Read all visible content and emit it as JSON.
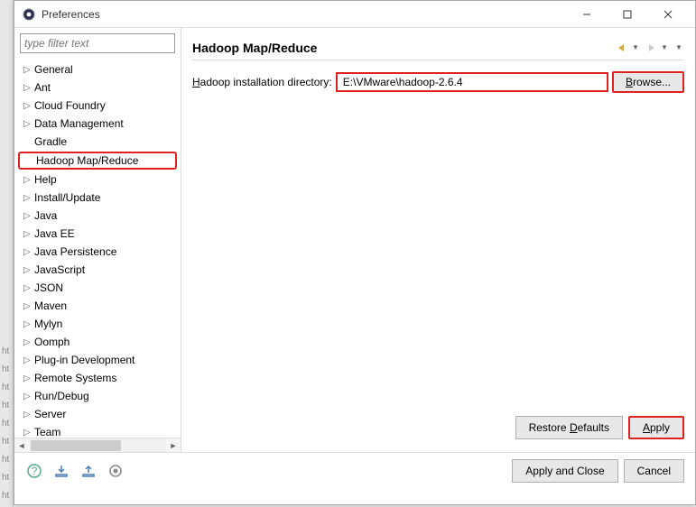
{
  "window": {
    "title": "Preferences"
  },
  "filter": {
    "placeholder": "type filter text"
  },
  "tree": {
    "items": [
      {
        "label": "General",
        "expandable": true
      },
      {
        "label": "Ant",
        "expandable": true
      },
      {
        "label": "Cloud Foundry",
        "expandable": true
      },
      {
        "label": "Data Management",
        "expandable": true
      },
      {
        "label": "Gradle",
        "expandable": false
      },
      {
        "label": "Hadoop Map/Reduce",
        "expandable": false,
        "highlighted": true
      },
      {
        "label": "Help",
        "expandable": true
      },
      {
        "label": "Install/Update",
        "expandable": true
      },
      {
        "label": "Java",
        "expandable": true
      },
      {
        "label": "Java EE",
        "expandable": true
      },
      {
        "label": "Java Persistence",
        "expandable": true
      },
      {
        "label": "JavaScript",
        "expandable": true
      },
      {
        "label": "JSON",
        "expandable": true
      },
      {
        "label": "Maven",
        "expandable": true
      },
      {
        "label": "Mylyn",
        "expandable": true
      },
      {
        "label": "Oomph",
        "expandable": true
      },
      {
        "label": "Plug-in Development",
        "expandable": true
      },
      {
        "label": "Remote Systems",
        "expandable": true
      },
      {
        "label": "Run/Debug",
        "expandable": true
      },
      {
        "label": "Server",
        "expandable": true
      },
      {
        "label": "Team",
        "expandable": true
      }
    ]
  },
  "main": {
    "heading": "Hadoop Map/Reduce",
    "field_label_pre": "H",
    "field_label_rest": "adoop installation directory:",
    "directory_value": "E:\\VMware\\hadoop-2.6.4",
    "browse_pre": "B",
    "browse_rest": "rowse..."
  },
  "buttons": {
    "restore_pre": "Restore ",
    "restore_u": "D",
    "restore_post": "efaults",
    "apply_u": "A",
    "apply_post": "pply",
    "apply_close": "Apply and Close",
    "cancel": "Cancel"
  },
  "left_edge_ticks": [
    "ht",
    "ht",
    "ht",
    "ht",
    "ht",
    "ht",
    "ht",
    "ht",
    "ht"
  ]
}
